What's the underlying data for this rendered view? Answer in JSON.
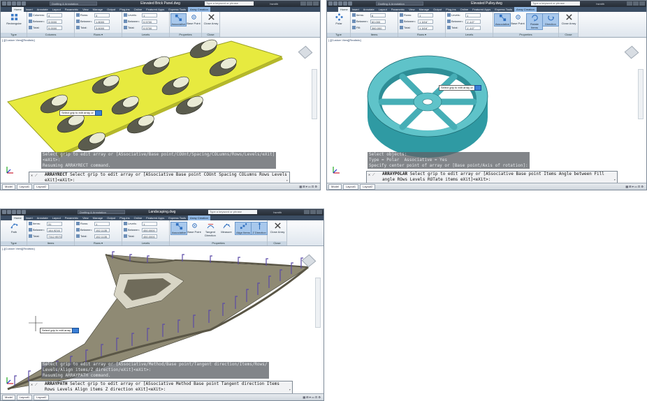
{
  "screens": [
    {
      "title": "Elevated Brick Panel.dwg",
      "workspace": "Drafting & Annotation",
      "search_placeholder": "Type a keyword or phrase",
      "user": "hsmith",
      "tabs": [
        "Home",
        "Insert",
        "Annotate",
        "Layout",
        "Parametric",
        "View",
        "Manage",
        "Output",
        "Plug-ins",
        "Online",
        "Featured Apps",
        "Express Tools",
        "Array Creation"
      ],
      "type_button": "Rectangular",
      "items": {
        "r1_label": "Columns:",
        "r1_value": "4",
        "r2_label": "Between:",
        "r2_value": "3.0000",
        "r3_label": "Total:",
        "r3_value": "9.0000",
        "title": "Columns"
      },
      "rows": {
        "r1_label": "Rows:",
        "r1_value": "3",
        "r2_label": "Between:",
        "r2_value": "1.8000",
        "r3_label": "Total:",
        "r3_value": "3.6000",
        "title": "Rows ▾"
      },
      "levels": {
        "r1_label": "Levels:",
        "r1_value": "1",
        "r2_label": "Between:",
        "r2_value": "0.5700",
        "r3_label": "Total:",
        "r3_value": "0.5700",
        "title": "Levels"
      },
      "props": [
        "Associative",
        "Base Point"
      ],
      "close": "Close Array",
      "panel_titles": {
        "type": "Type",
        "properties": "Properties",
        "close": "Close"
      },
      "view_label": "[-][Custom View][Realistic]",
      "grip_tip": "Select grip to edit array or",
      "history": [
        "Select grip to edit array or [ASsociative/Base point/COUnt/Spacing/COLumns/Rows/Levels/eXit]",
        "<eXit>:",
        "Resuming ARRAYRECT command."
      ],
      "cmd_name": "ARRAYRECT",
      "cmd_text": "Select grip to edit array or [ASsociative Base point COUnt Spacing COLumns Rows Levels eXit]<eXit>:",
      "status_tabs": [
        "Model",
        "Layout1",
        "Layout2"
      ]
    },
    {
      "title": "Elevated Pulley.dwg",
      "workspace": "Drafting & Annotation",
      "search_placeholder": "Type a keyword or phrase",
      "user": "hsmith",
      "tabs": [
        "Home",
        "Insert",
        "Annotate",
        "Layout",
        "Parametric",
        "View",
        "Manage",
        "Output",
        "Plug-ins",
        "Online",
        "Featured Apps",
        "Express Tools",
        "Array Creation"
      ],
      "type_button": "Polar",
      "items": {
        "r1_label": "Items:",
        "r1_value": "6",
        "r2_label": "Between:",
        "r2_value": "60.000",
        "r3_label": "Fill:",
        "r3_value": "360.000",
        "title": "Items"
      },
      "rows": {
        "r1_label": "Rows:",
        "r1_value": "1",
        "r2_label": "Between:",
        "r2_value": "1 3/16\"",
        "r3_label": "Total:",
        "r3_value": "1 3/16\"",
        "title": "Rows ▾"
      },
      "levels": {
        "r1_label": "Levels:",
        "r1_value": "1",
        "r2_label": "Between:",
        "r2_value": "1'-1/2\"",
        "r3_label": "Total:",
        "r3_value": "1'-1/2\"",
        "title": "Levels"
      },
      "props": [
        "Associative",
        "Base Point",
        "Rotate Items",
        "Direction"
      ],
      "close": "Close Array",
      "panel_titles": {
        "type": "Type",
        "properties": "Properties",
        "close": "Close"
      },
      "view_label": "[-][Custom View][Realistic]",
      "grip_tip": "Select grip to edit array or",
      "history": [
        "Select objects:",
        "Type = Polar  Associative = Yes",
        "Specify center point of array or [Base point/Axis of rotation]:"
      ],
      "cmd_name": "ARRAYPOLAR",
      "cmd_text": "Select grip to edit array or [ASsociative Base point Items Angle between Fill angle ROws Levels ROTate items eXit]<eXit>:",
      "status_tabs": [
        "Model",
        "Layout1",
        "Layout2"
      ]
    },
    {
      "title": "Landscaping.dwg",
      "workspace": "Drafting & Annotation",
      "search_placeholder": "Type a keyword or phrase",
      "user": "hsmith",
      "tabs": [
        "Home",
        "Insert",
        "Annotate",
        "Layout",
        "Parametric",
        "View",
        "Manage",
        "Output",
        "Plug-ins",
        "Online",
        "Featured Apps",
        "Express Tools",
        "Array Creation"
      ],
      "type_button": "Path",
      "items": {
        "r1_label": "Items:",
        "r1_value": "31",
        "r2_label": "Between:",
        "r2_value": "144.9216",
        "r3_label": "Total:",
        "r3_value": "7312.9570",
        "title": "Items"
      },
      "rows": {
        "r1_label": "Rows:",
        "r1_value": "1",
        "r2_label": "Between:",
        "r2_value": "152.1135",
        "r3_label": "Total:",
        "r3_value": "152.1135",
        "title": "Rows ▾"
      },
      "levels": {
        "r1_label": "Levels:",
        "r1_value": "1",
        "r2_label": "Between:",
        "r2_value": "450.0000",
        "r3_label": "Total:",
        "r3_value": "450.0000",
        "title": "Levels"
      },
      "props": [
        "Associative",
        "Base Point",
        "Tangent Direction",
        "Measure",
        "Align Items",
        "Z Direction"
      ],
      "close": "Close Array",
      "panel_titles": {
        "type": "Type",
        "properties": "Properties",
        "close": "Close"
      },
      "view_label": "[-][Custom View][Realistic]",
      "grip_tip": "Select grip to edit array",
      "history": [
        "Select grip to edit array or [ASsociative/Method/Base point/Tangent direction/Items/Rows/",
        "Levels/Align items/Z direction/eXit]<eXit>:",
        "Resuming ARRAYPATH command."
      ],
      "cmd_name": "ARRAYPATH",
      "cmd_text": "Select grip to edit array or [ASsociative Method Base point Tangent direction Items Rows Levels Align items Z direction eXit]<eXit>:",
      "status_tabs": [
        "Model",
        "Layout1",
        "Layout2"
      ]
    }
  ]
}
